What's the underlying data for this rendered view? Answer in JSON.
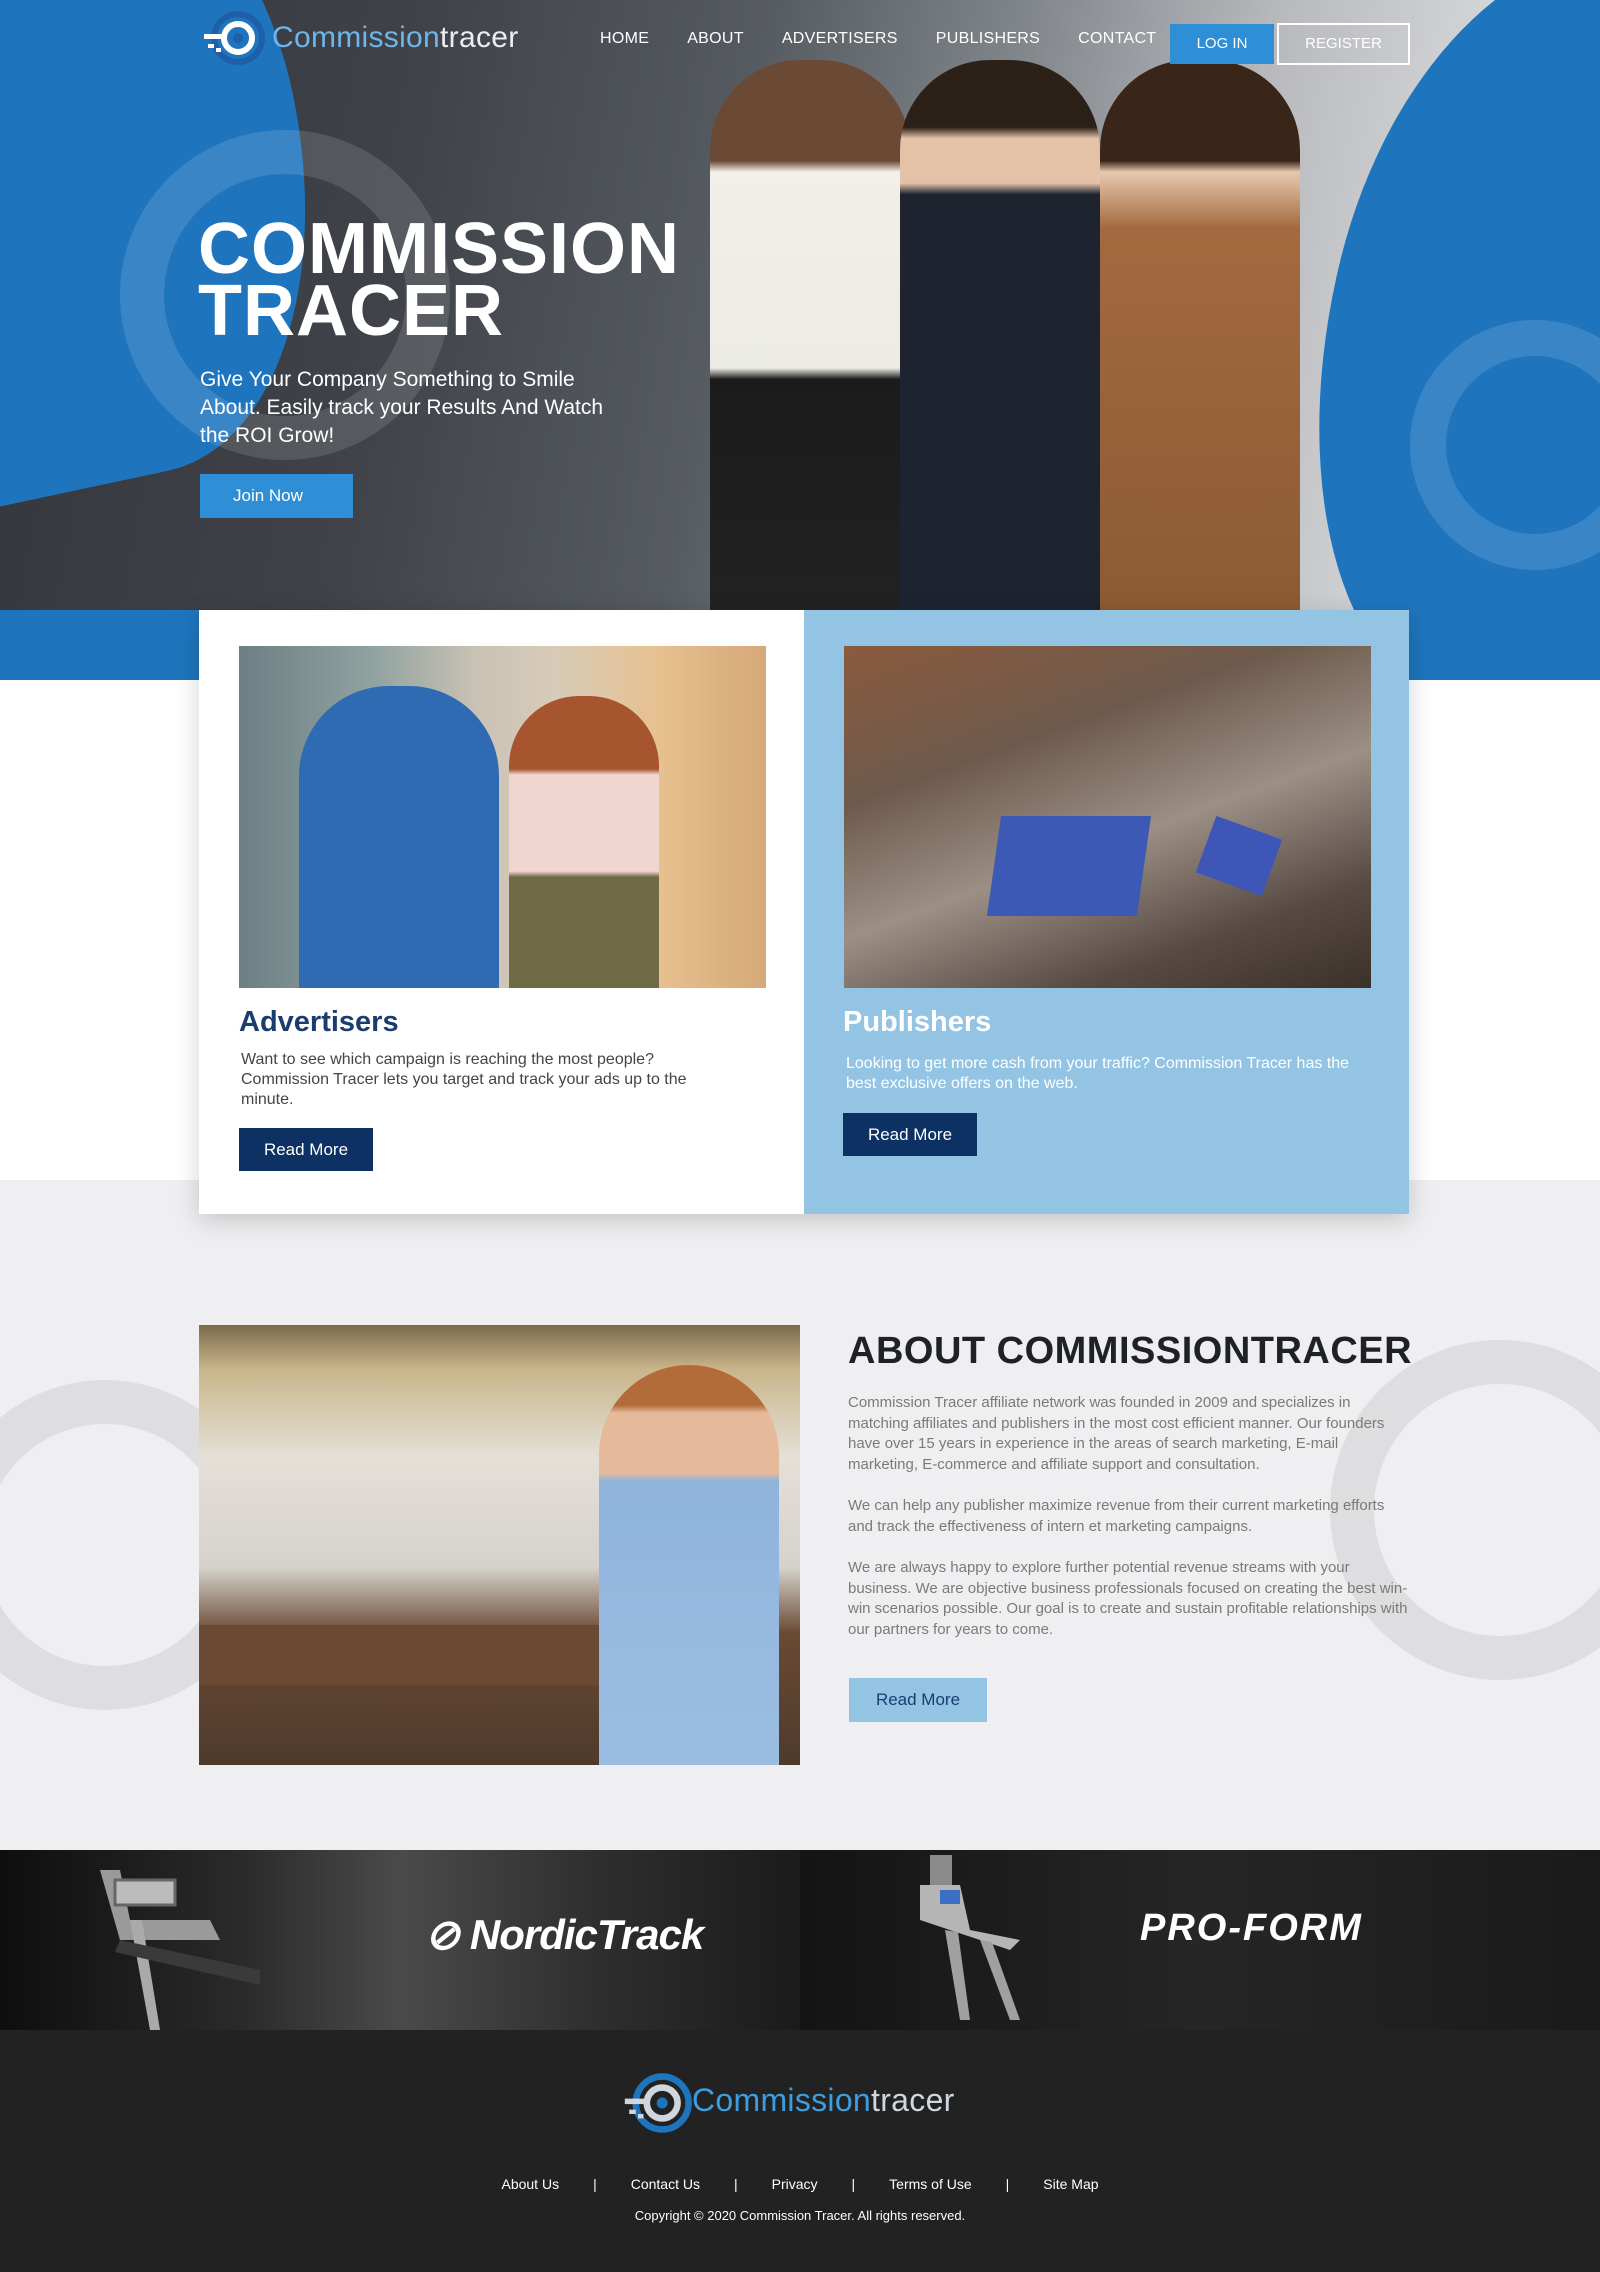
{
  "brand": {
    "name_part1": "Commission",
    "name_part2": "tracer"
  },
  "nav": {
    "links": [
      "HOME",
      "ABOUT",
      "ADVERTISERS",
      "PUBLISHERS",
      "CONTACT"
    ],
    "login_label": "LOG IN",
    "register_label": "REGISTER"
  },
  "hero": {
    "title_line1": "COMMISSION",
    "title_line2": "TRACER",
    "subtitle": "Give Your Company Something to Smile About. Easily track your Results And Watch the ROI Grow!",
    "cta_label": "Join Now"
  },
  "cards": {
    "advertisers": {
      "title": "Advertisers",
      "text": "Want to see which campaign is reaching the most people? Commission Tracer lets you target and track your ads up to the minute.",
      "button": "Read More"
    },
    "publishers": {
      "title": "Publishers",
      "text": "Looking to get more cash from your traffic? Commission Tracer has the best exclusive offers on the web.",
      "button": "Read More"
    }
  },
  "about": {
    "title": "ABOUT COMMISSIONTRACER",
    "paragraphs": [
      "Commission Tracer affiliate network was founded in 2009 and specializes in matching affiliates and publishers in the most cost efficient manner. Our founders have over 15 years in experience in the areas of search marketing, E-mail marketing, E-commerce and affiliate support and consultation.",
      "We can help any publisher maximize revenue from their current marketing efforts and track the effectiveness of intern et marketing campaigns.",
      "We are always happy to explore further potential revenue streams with your business. We are objective business professionals focused on creating the best win-win scenarios possible. Our goal is to create and sustain profitable relationships with our partners for years to come."
    ],
    "button": "Read More"
  },
  "brands": {
    "left": "NordicTrack",
    "right": "PRO-FORM"
  },
  "footer": {
    "links": [
      "About Us",
      "Contact Us",
      "Privacy",
      "Terms of Use",
      "Site Map"
    ],
    "separator": "|",
    "copyright": "Copyright © 2020 Commission Tracer. All rights reserved."
  },
  "colors": {
    "primary_blue": "#1f75bd",
    "button_blue": "#2e8ed6",
    "navy": "#0d3162",
    "light_blue": "#93c4e4",
    "footer_bg": "#222222"
  }
}
